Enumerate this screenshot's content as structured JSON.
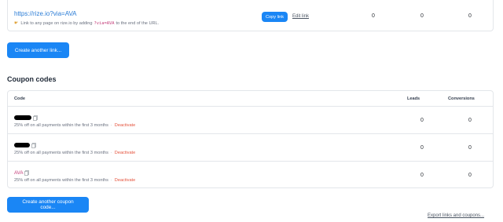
{
  "referral_link": {
    "url": "https://rize.io?via=AVA",
    "hint_prefix": "Link to any page on rize.io by adding",
    "hint_code": "?via=AVA",
    "hint_suffix": "to the end of the URL.",
    "copy_label": "Copy link",
    "edit_label": "Edit link",
    "stats": [
      "0",
      "0",
      "0"
    ]
  },
  "create_link_label": "Create another link...",
  "coupons": {
    "title": "Coupon codes",
    "columns": {
      "code": "Code",
      "leads": "Leads",
      "conversions": "Conversions"
    },
    "rows": [
      {
        "code": "",
        "redacted": true,
        "description": "25% off on all payments within the first 3 months",
        "separator": "·",
        "action": "Deactivate",
        "leads": "0",
        "conversions": "0"
      },
      {
        "code": "",
        "redacted": true,
        "description": "25% off on all payments within the first 3 months",
        "separator": "·",
        "action": "Deactivate",
        "leads": "0",
        "conversions": "0"
      },
      {
        "code": "AVA",
        "redacted": false,
        "description": "25% off on all payments within the first 3 months",
        "separator": "·",
        "action": "Deactivate",
        "leads": "0",
        "conversions": "0"
      }
    ]
  },
  "create_coupon_label": "Create another coupon code...",
  "export_label": "Export links and coupons...",
  "colors": {
    "primary": "#1a86f5",
    "danger": "#e5533d",
    "code": "#c43d7a"
  },
  "icons": {
    "hint": "pointing-hand-icon",
    "copy": "copy-icon"
  }
}
